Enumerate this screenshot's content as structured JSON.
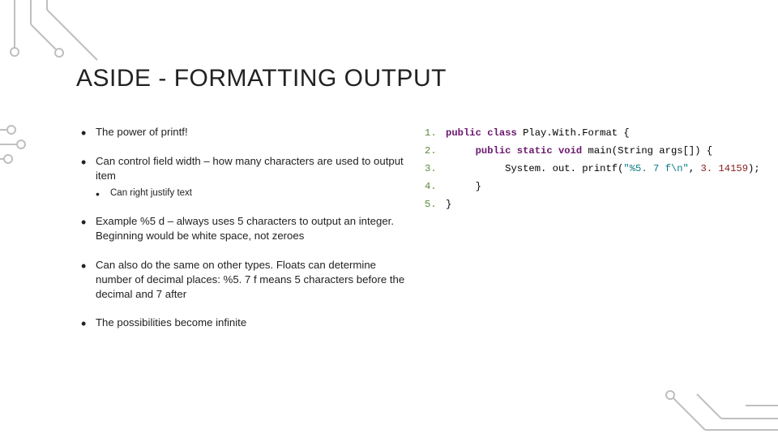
{
  "title": "ASIDE - FORMATTING OUTPUT",
  "bullets": {
    "b1": "The power of printf!",
    "b2": "Can control field width – how many characters are used to output item",
    "b2a": "Can right justify text",
    "b3": "Example %5 d – always uses 5 characters to output an integer. Beginning would be white space, not zeroes",
    "b4": "Can also do the same on other types. Floats can determine number of decimal places: %5. 7 f means 5 characters before the decimal and 7 after",
    "b5": "The possibilities become infinite"
  },
  "code": {
    "ln1": "1.",
    "ln2": "2.",
    "ln3": "3.",
    "ln4": "4.",
    "ln5": "5.",
    "l1": {
      "a": "public class ",
      "b": "Play.With.Format ",
      "c": "{"
    },
    "l2": {
      "pad": "     ",
      "a": "public static void ",
      "b": "main(String args[]) {"
    },
    "l3": {
      "pad": "          ",
      "a": "System. out. printf(",
      "b": "\"%5. 7 f\\n\"",
      "c": ", ",
      "d": "3. 14159",
      "e": ");"
    },
    "l4": {
      "pad": "     ",
      "a": "}"
    },
    "l5": {
      "a": "}"
    }
  }
}
